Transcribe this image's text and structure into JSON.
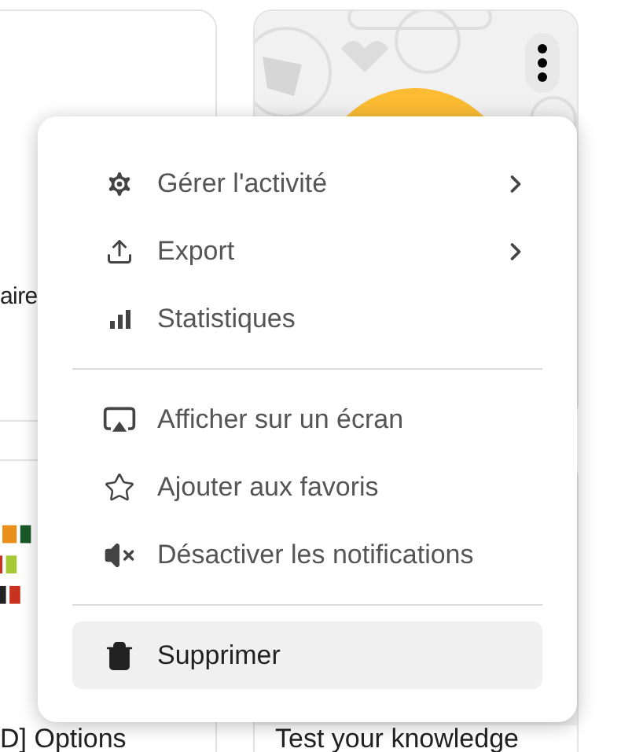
{
  "cards": [
    {
      "kind": "blank",
      "title": "aire"
    },
    {
      "kind": "picture"
    },
    {
      "kind": "picture",
      "title": "D] Options"
    },
    {
      "kind": "picture",
      "title": "Test your knowledge"
    }
  ],
  "menu": {
    "groups": [
      [
        {
          "label": "Gérer l'activité",
          "submenu": true,
          "highlighted": false
        },
        {
          "label": "Export",
          "submenu": true,
          "highlighted": false
        },
        {
          "label": "Statistiques",
          "submenu": false,
          "highlighted": false
        }
      ],
      [
        {
          "label": "Afficher sur un écran",
          "submenu": false,
          "highlighted": false
        },
        {
          "label": "Ajouter aux favoris",
          "submenu": false,
          "highlighted": false
        },
        {
          "label": "Désactiver les notifications",
          "submenu": false,
          "highlighted": false
        }
      ],
      [
        {
          "label": "Supprimer",
          "submenu": false,
          "highlighted": true
        }
      ]
    ]
  }
}
